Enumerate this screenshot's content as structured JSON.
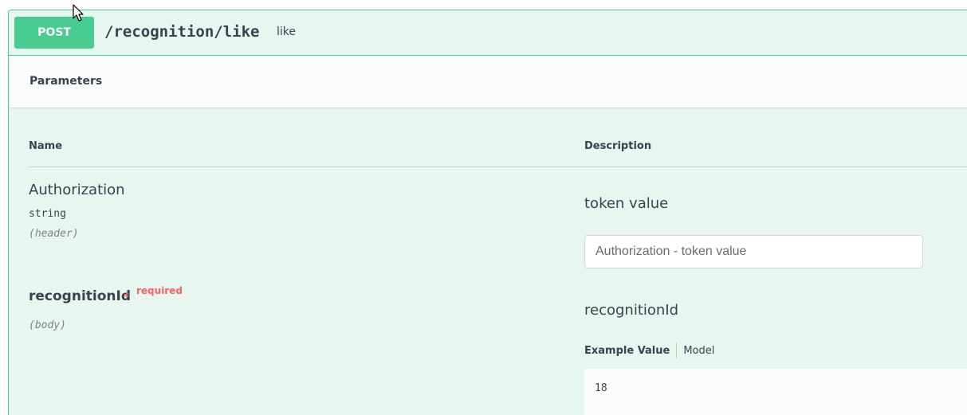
{
  "operation": {
    "method": "POST",
    "path": "/recognition/like",
    "summary": "like"
  },
  "parameters_section": {
    "title": "Parameters",
    "columns": {
      "name": "Name",
      "description": "Description"
    },
    "items": [
      {
        "name": "Authorization",
        "type": "string",
        "in": "(header)",
        "description": "token value",
        "input_placeholder": "Authorization - token value",
        "input_value": ""
      },
      {
        "name": "recognitionId",
        "required_marker": "*",
        "required_label": "required",
        "in": "(body)",
        "description": "recognitionId",
        "tabs": {
          "example": "Example Value",
          "model": "Model"
        },
        "example_value": "18"
      }
    ]
  },
  "colors": {
    "method_post": "#49cc90",
    "block_background": "#e8f6f0",
    "required": "#ff6060"
  },
  "icons": {
    "cursor": "mouse-pointer-icon"
  }
}
